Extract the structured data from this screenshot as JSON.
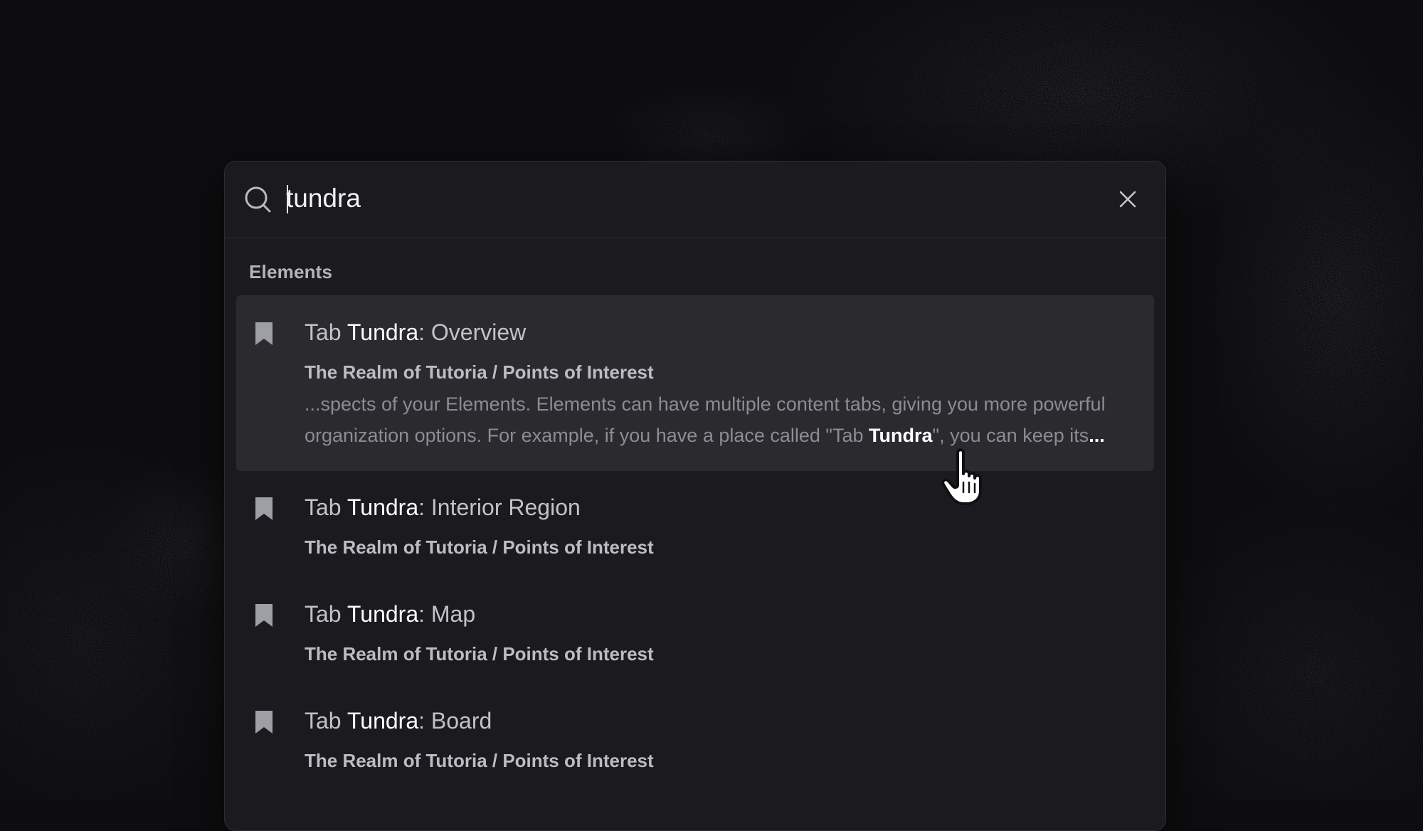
{
  "search": {
    "query": "tundra",
    "placeholder": ""
  },
  "section": {
    "title": "Elements"
  },
  "results": [
    {
      "prefix": "Tab ",
      "match": "Tundra",
      "suffix": ": Overview",
      "path": "The Realm of Tutoria / Points of Interest",
      "snippet_line1": "...spects of your Elements. Elements can have multiple content tabs, giving you more powerful",
      "snippet_line2_before": "organization options. For example, if you have a place called \"Tab ",
      "snippet_match": "Tundra",
      "snippet_line2_after": "\", you can keep its",
      "snippet_ellipsis": "..."
    },
    {
      "prefix": "Tab ",
      "match": "Tundra",
      "suffix": ": Interior Region",
      "path": "The Realm of Tutoria / Points of Interest"
    },
    {
      "prefix": "Tab ",
      "match": "Tundra",
      "suffix": ": Map",
      "path": "The Realm of Tutoria / Points of Interest"
    },
    {
      "prefix": "Tab ",
      "match": "Tundra",
      "suffix": ": Board",
      "path": "The Realm of Tutoria / Points of Interest"
    }
  ],
  "icons": {
    "search": "search-icon",
    "close": "close-icon",
    "result": "bookmark-icon",
    "pointer": "hand-pointer-icon"
  },
  "colors": {
    "background": "#0d0d0f",
    "panel": "#1b1b1f",
    "active_row": "#2a2a2f",
    "highlight_text": "#ffffff",
    "muted_text": "#8c8c93"
  }
}
